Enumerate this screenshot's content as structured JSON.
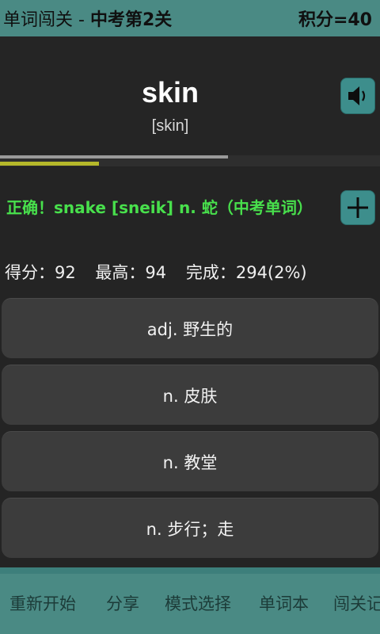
{
  "header": {
    "title": "单词闯关 - ",
    "level": "中考第2关",
    "score": "积分=40"
  },
  "word": {
    "text": "skin",
    "phonetic": "[skin]"
  },
  "progress": {
    "fraction": 0.26,
    "secondary_fraction": 0.6
  },
  "feedback": {
    "text": "正确！snake [sneik] n. 蛇（中考单词）"
  },
  "stats": {
    "current": "得分：92",
    "best": "最高：94",
    "completed": "完成：294(2%)"
  },
  "options": [
    "adj. 野生的",
    "n. 皮肤",
    "n. 教堂",
    "n. 步行；走"
  ],
  "menu": [
    "重新开始",
    "分享",
    "模式选择",
    "单词本",
    "闯关记录"
  ],
  "colors": {
    "accent": "#4a8a84",
    "correct": "#48e04c",
    "progress": "#b5b82a"
  },
  "icons": {
    "speaker": "speaker-icon",
    "add": "plus-icon"
  }
}
